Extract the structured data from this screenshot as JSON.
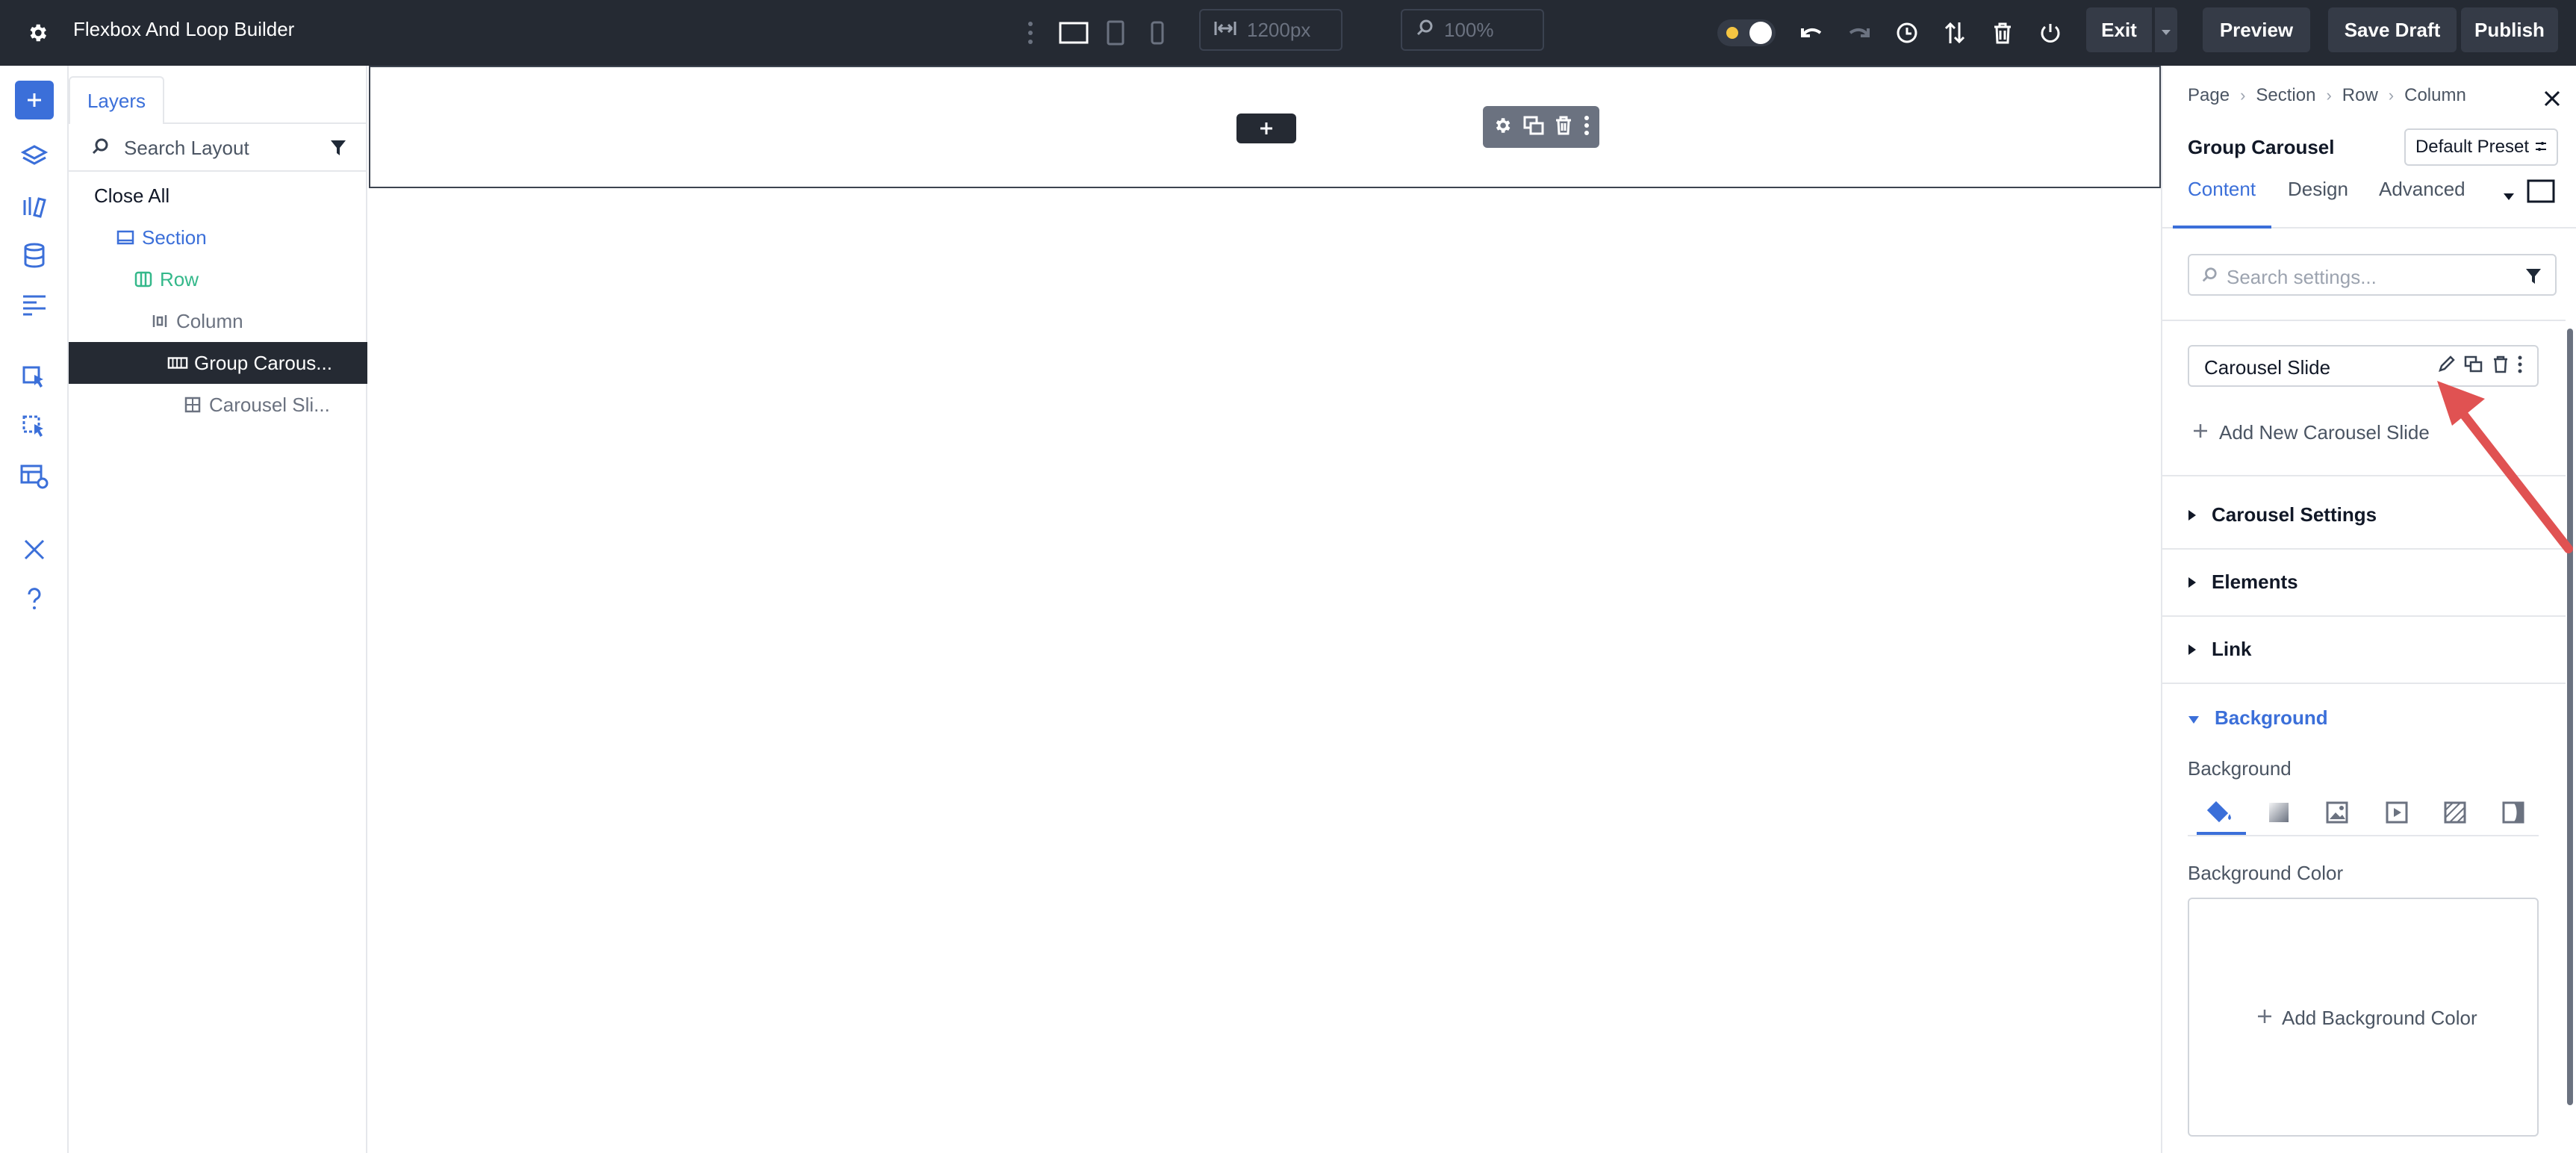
{
  "topbar": {
    "title": "Flexbox And Loop Builder",
    "width_value": "1200px",
    "zoom_value": "100%",
    "exit_label": "Exit",
    "preview_label": "Preview",
    "save_draft_label": "Save Draft",
    "publish_label": "Publish"
  },
  "layers": {
    "tab_label": "Layers",
    "search_placeholder": "Search Layout",
    "close_all": "Close All",
    "items": [
      {
        "label": "Section",
        "color": "#3b6fd9"
      },
      {
        "label": "Row",
        "color": "#34b88a"
      },
      {
        "label": "Column",
        "color": "#6b7280"
      },
      {
        "label": "Group Carous...",
        "color": "#ffffff"
      },
      {
        "label": "Carousel Sli...",
        "color": "#6b7280"
      }
    ]
  },
  "panel": {
    "breadcrumbs": [
      "Page",
      "Section",
      "Row",
      "Column"
    ],
    "title": "Group Carousel",
    "preset_label": "Default Preset",
    "tabs": [
      "Content",
      "Design",
      "Advanced"
    ],
    "search_placeholder": "Search settings...",
    "slide_item_label": "Carousel Slide",
    "add_new_slide": "Add New Carousel Slide",
    "accordions": [
      "Carousel Settings",
      "Elements",
      "Link",
      "Background"
    ],
    "background_label": "Background",
    "background_color_label": "Background Color",
    "add_background_color": "Add Background Color"
  },
  "colors": {
    "topbar_bg": "#252a33",
    "accent": "#3b6fd9",
    "selected_row_bg": "#252a33",
    "arrow": "#e05252"
  }
}
